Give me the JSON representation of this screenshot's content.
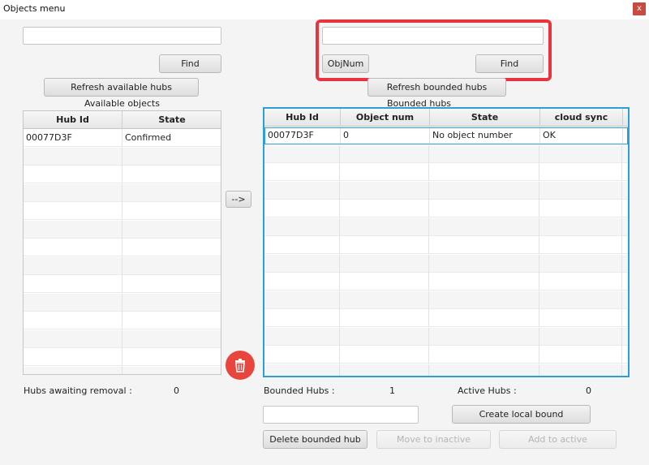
{
  "window": {
    "title": "Objects menu",
    "close_glyph": "x"
  },
  "left": {
    "search_value": "",
    "find_label": "Find",
    "refresh_label": "Refresh available hubs",
    "caption": "Available objects",
    "columns": [
      "Hub Id",
      "State"
    ],
    "rows": [
      [
        "00077D3F",
        "Confirmed"
      ]
    ],
    "awaiting_label": "Hubs awaiting removal :",
    "awaiting_count": "0"
  },
  "transfer_label": "-->",
  "right": {
    "search_value": "",
    "objnum_label": "ObjNum",
    "find_label": "Find",
    "refresh_label": "Refresh bounded hubs",
    "caption": "Bounded hubs",
    "columns": [
      "Hub Id",
      "Object num",
      "State",
      "cloud sync"
    ],
    "rows": [
      [
        "00077D3F",
        "0",
        "No object number",
        "OK"
      ]
    ],
    "bounded_label": "Bounded Hubs :",
    "bounded_count": "1",
    "active_label": "Active Hubs :",
    "active_count": "0",
    "bound_input_value": "",
    "create_local_label": "Create local bound",
    "delete_label": "Delete bounded hub",
    "move_inactive_label": "Move to inactive",
    "add_active_label": "Add to active"
  },
  "colors": {
    "highlight": "#e8343f",
    "table_border": "#2aa0d4",
    "trash": "#e9453f"
  },
  "icons": {
    "close": "close-icon",
    "trash": "trash-icon"
  }
}
